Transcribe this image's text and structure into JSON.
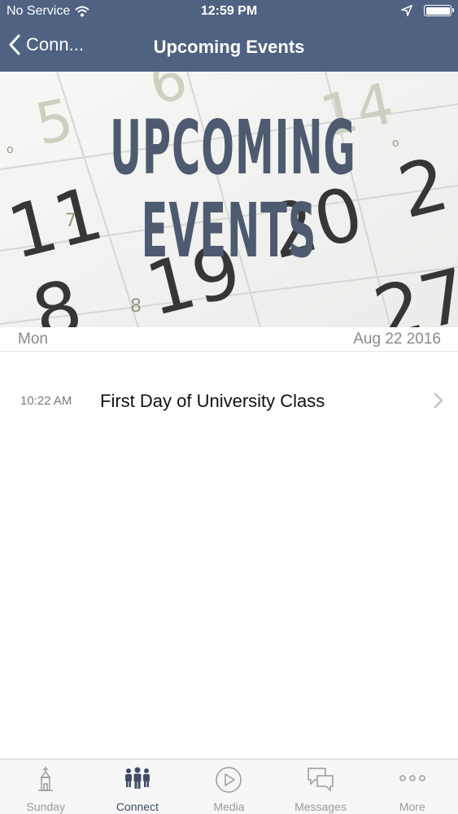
{
  "status_bar": {
    "carrier": "No Service",
    "time": "12:59 PM"
  },
  "nav": {
    "back_label": "Conn...",
    "title": "Upcoming Events"
  },
  "banner": {
    "line1": "UPCOMING",
    "line2": "EVENTS"
  },
  "day_header": {
    "day": "Mon",
    "date": "Aug 22 2016"
  },
  "events": [
    {
      "time": "10:22 AM",
      "title": "First Day of University Class"
    }
  ],
  "tabs": [
    {
      "label": "Sunday",
      "icon": "church-icon",
      "active": false
    },
    {
      "label": "Connect",
      "icon": "people-icon",
      "active": true
    },
    {
      "label": "Media",
      "icon": "play-circle-icon",
      "active": false
    },
    {
      "label": "Messages",
      "icon": "chat-bubbles-icon",
      "active": false
    },
    {
      "label": "More",
      "icon": "more-dots-icon",
      "active": false
    }
  ],
  "colors": {
    "header_bg": "#4f6282",
    "active_tab": "#3f4c63",
    "inactive_tab": "#9a9aa0"
  }
}
